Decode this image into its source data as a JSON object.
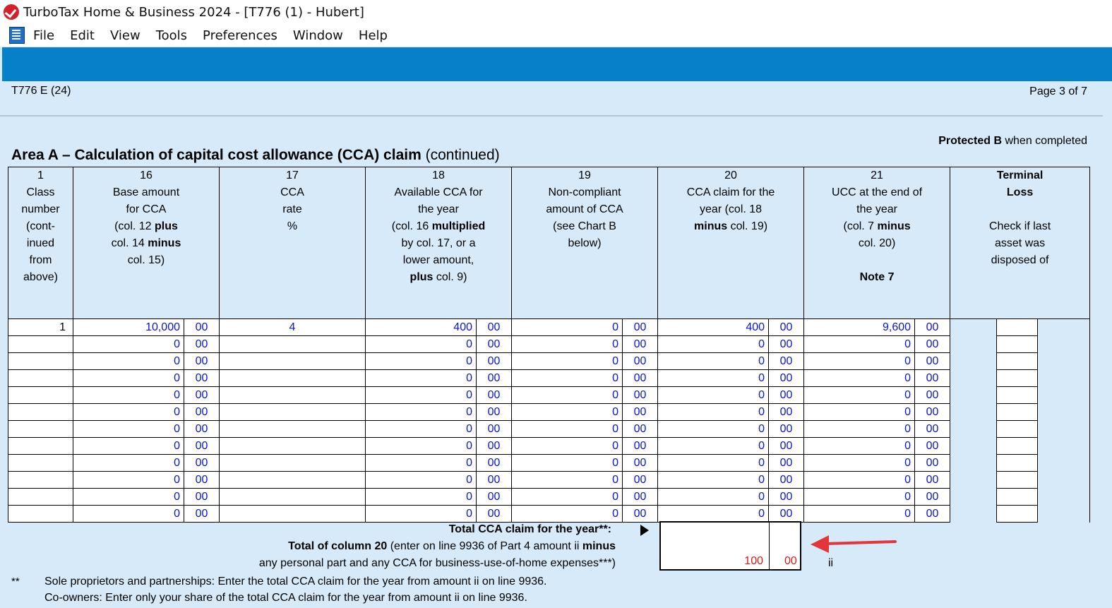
{
  "window": {
    "title": "TurboTax Home & Business 2024 - [T776 (1) - Hubert]"
  },
  "menu": {
    "items": [
      "File",
      "Edit",
      "View",
      "Tools",
      "Preferences",
      "Window",
      "Help"
    ]
  },
  "form": {
    "id": "T776 E (24)",
    "page": "Page 3 of 7",
    "protected_bold": "Protected B",
    "protected_rest": " when completed",
    "heading_bold": "Area A – Calculation of capital cost allowance (CCA) claim",
    "heading_rest": " (continued)"
  },
  "columns": {
    "c1": {
      "num": "1",
      "l1": "Class",
      "l2": "number",
      "l3": "(cont-",
      "l4": "inued",
      "l5": "from",
      "l6": "above)"
    },
    "c16": {
      "num": "16",
      "l1": "Base amount",
      "l2": "for CCA",
      "l3a": "(col. 12 ",
      "l3b": "plus",
      "l4a": "col. 14 ",
      "l4b": "minus",
      "l5": "col. 15)"
    },
    "c17": {
      "num": "17",
      "l1": "CCA",
      "l2": "rate",
      "l3": "%"
    },
    "c18": {
      "num": "18",
      "l1": "Available CCA for",
      "l2": "the year",
      "l3a": "(col. 16 ",
      "l3b": "multiplied",
      "l4": "by col. 17, or a",
      "l5": "lower amount,",
      "l6a": "plus",
      "l6b": " col. 9)"
    },
    "c19": {
      "num": "19",
      "l1": "Non-compliant",
      "l2": "amount of CCA",
      "l3": "(see Chart B",
      "l4": "below)"
    },
    "c20": {
      "num": "20",
      "l1": "CCA claim for the",
      "l2": "year (col. 18",
      "l3a": "minus",
      "l3b": " col. 19)"
    },
    "c21": {
      "num": "21",
      "l1": "UCC at the end of",
      "l2": "the year",
      "l3a": "(col. 7 ",
      "l3b": "minus",
      "l4": "col. 20)",
      "l6": "Note 7"
    },
    "term": {
      "l1": "Terminal",
      "l2": "Loss",
      "l4": "Check if last",
      "l5": "asset was",
      "l6": "disposed of"
    }
  },
  "rows": [
    {
      "cls": "1",
      "c16": "10,000",
      "c16c": "00",
      "c17": "4",
      "c18": "400",
      "c18c": "00",
      "c19": "0",
      "c19c": "00",
      "c20": "400",
      "c20c": "00",
      "c21": "9,600",
      "c21c": "00"
    },
    {
      "cls": "",
      "c16": "0",
      "c16c": "00",
      "c17": "",
      "c18": "0",
      "c18c": "00",
      "c19": "0",
      "c19c": "00",
      "c20": "0",
      "c20c": "00",
      "c21": "0",
      "c21c": "00"
    },
    {
      "cls": "",
      "c16": "0",
      "c16c": "00",
      "c17": "",
      "c18": "0",
      "c18c": "00",
      "c19": "0",
      "c19c": "00",
      "c20": "0",
      "c20c": "00",
      "c21": "0",
      "c21c": "00"
    },
    {
      "cls": "",
      "c16": "0",
      "c16c": "00",
      "c17": "",
      "c18": "0",
      "c18c": "00",
      "c19": "0",
      "c19c": "00",
      "c20": "0",
      "c20c": "00",
      "c21": "0",
      "c21c": "00"
    },
    {
      "cls": "",
      "c16": "0",
      "c16c": "00",
      "c17": "",
      "c18": "0",
      "c18c": "00",
      "c19": "0",
      "c19c": "00",
      "c20": "0",
      "c20c": "00",
      "c21": "0",
      "c21c": "00"
    },
    {
      "cls": "",
      "c16": "0",
      "c16c": "00",
      "c17": "",
      "c18": "0",
      "c18c": "00",
      "c19": "0",
      "c19c": "00",
      "c20": "0",
      "c20c": "00",
      "c21": "0",
      "c21c": "00"
    },
    {
      "cls": "",
      "c16": "0",
      "c16c": "00",
      "c17": "",
      "c18": "0",
      "c18c": "00",
      "c19": "0",
      "c19c": "00",
      "c20": "0",
      "c20c": "00",
      "c21": "0",
      "c21c": "00"
    },
    {
      "cls": "",
      "c16": "0",
      "c16c": "00",
      "c17": "",
      "c18": "0",
      "c18c": "00",
      "c19": "0",
      "c19c": "00",
      "c20": "0",
      "c20c": "00",
      "c21": "0",
      "c21c": "00"
    },
    {
      "cls": "",
      "c16": "0",
      "c16c": "00",
      "c17": "",
      "c18": "0",
      "c18c": "00",
      "c19": "0",
      "c19c": "00",
      "c20": "0",
      "c20c": "00",
      "c21": "0",
      "c21c": "00"
    },
    {
      "cls": "",
      "c16": "0",
      "c16c": "00",
      "c17": "",
      "c18": "0",
      "c18c": "00",
      "c19": "0",
      "c19c": "00",
      "c20": "0",
      "c20c": "00",
      "c21": "0",
      "c21c": "00"
    },
    {
      "cls": "",
      "c16": "0",
      "c16c": "00",
      "c17": "",
      "c18": "0",
      "c18c": "00",
      "c19": "0",
      "c19c": "00",
      "c20": "0",
      "c20c": "00",
      "c21": "0",
      "c21c": "00"
    },
    {
      "cls": "",
      "c16": "0",
      "c16c": "00",
      "c17": "",
      "c18": "0",
      "c18c": "00",
      "c19": "0",
      "c19c": "00",
      "c20": "0",
      "c20c": "00",
      "c21": "0",
      "c21c": "00"
    }
  ],
  "total": {
    "line1": "Total CCA claim for the year**:",
    "line2_bold_a": "Total of column 20",
    "line2_mid": " (enter on line 9936 of Part 4 amount ii ",
    "line2_bold_b": "minus",
    "line3": "any personal part and any CCA for business-use-of-home expenses***)",
    "dollars": "100",
    "cents": "00",
    "line_label": "ii"
  },
  "notes": {
    "marker": "**",
    "line1": "Sole proprietors and partnerships: Enter the total CCA claim for the year from amount ii on line 9936.",
    "line2": "Co-owners: Enter only your share of the total CCA claim for the year from amount ii on line 9936."
  },
  "colors": {
    "accent_bar": "#0680c8",
    "page_bg": "#d6eafa",
    "value_blue": "#0a14d8",
    "total_red": "#e01818",
    "arrow_red": "#e2363a"
  }
}
